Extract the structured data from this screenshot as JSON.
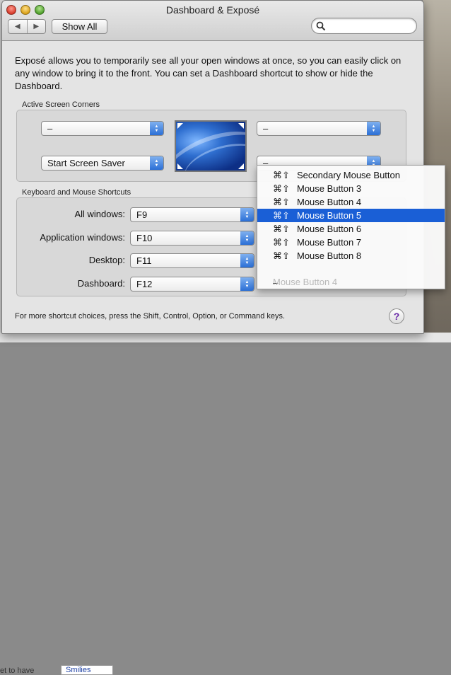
{
  "window": {
    "title": "Dashboard & Exposé"
  },
  "toolbar": {
    "back_icon": "◀",
    "forward_icon": "▶",
    "show_all_label": "Show All",
    "search_placeholder": ""
  },
  "description": "Exposé allows you to temporarily see all your open windows at once, so you can easily click on any window to bring it to the front. You can set a Dashboard shortcut to show or hide the Dashboard.",
  "corners": {
    "group_label": "Active Screen Corners",
    "top_left": "–",
    "top_right": "–",
    "bottom_left": "Start Screen Saver",
    "bottom_right": "–"
  },
  "shortcuts": {
    "group_label": "Keyboard and Mouse Shortcuts",
    "rows": [
      {
        "label": "All windows:",
        "key": "F9"
      },
      {
        "label": "Application windows:",
        "key": "F10"
      },
      {
        "label": "Desktop:",
        "key": "F11"
      },
      {
        "label": "Dashboard:",
        "key": "F12"
      }
    ],
    "hidden_mouse_value": "Mouse Button 4"
  },
  "menu": {
    "modifier": "⌘⇧",
    "items": [
      "Secondary Mouse Button",
      "Mouse Button 3",
      "Mouse Button 4",
      "Mouse Button 5",
      "Mouse Button 6",
      "Mouse Button 7",
      "Mouse Button 8"
    ],
    "selected_index": 3,
    "none_item": "–"
  },
  "footer": "For more shortcut choices, press the Shift, Control, Option, or Command keys.",
  "help_label": "?",
  "background": {
    "left_text": "et to have",
    "box_text": "Smilies"
  },
  "colors": {
    "selection": "#1a5fd6",
    "popup_arrows": "#2b6fd6"
  }
}
